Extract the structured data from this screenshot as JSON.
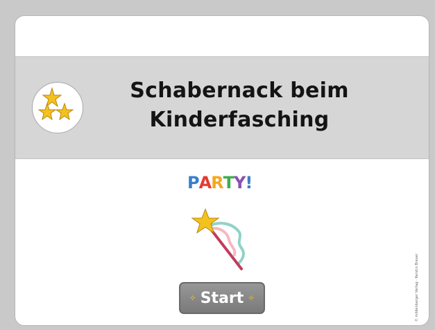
{
  "title": {
    "line1": "Schabernack beim",
    "line2": "Kinderfasching"
  },
  "party_logo": {
    "letters": [
      "P",
      "A",
      "R",
      "T",
      "Y",
      "!"
    ],
    "colors": [
      "#3a7fc8",
      "#e53b33",
      "#f4a81d",
      "#40ad4a",
      "#8a4fb0",
      "#3a7fc8"
    ]
  },
  "start_button": {
    "label": "Start"
  },
  "copyright": "© mildenberger Verlag · Kerstin Breuer",
  "icons": {
    "badge": "three-stars-icon",
    "wand": "magic-wand-icon",
    "sparkle": "sparkle-icon"
  },
  "colors": {
    "background": "#c9c9c9",
    "card": "#ffffff",
    "band": "#d6d6d6",
    "button": "#8a8a8a",
    "star": "#f4c21f"
  }
}
